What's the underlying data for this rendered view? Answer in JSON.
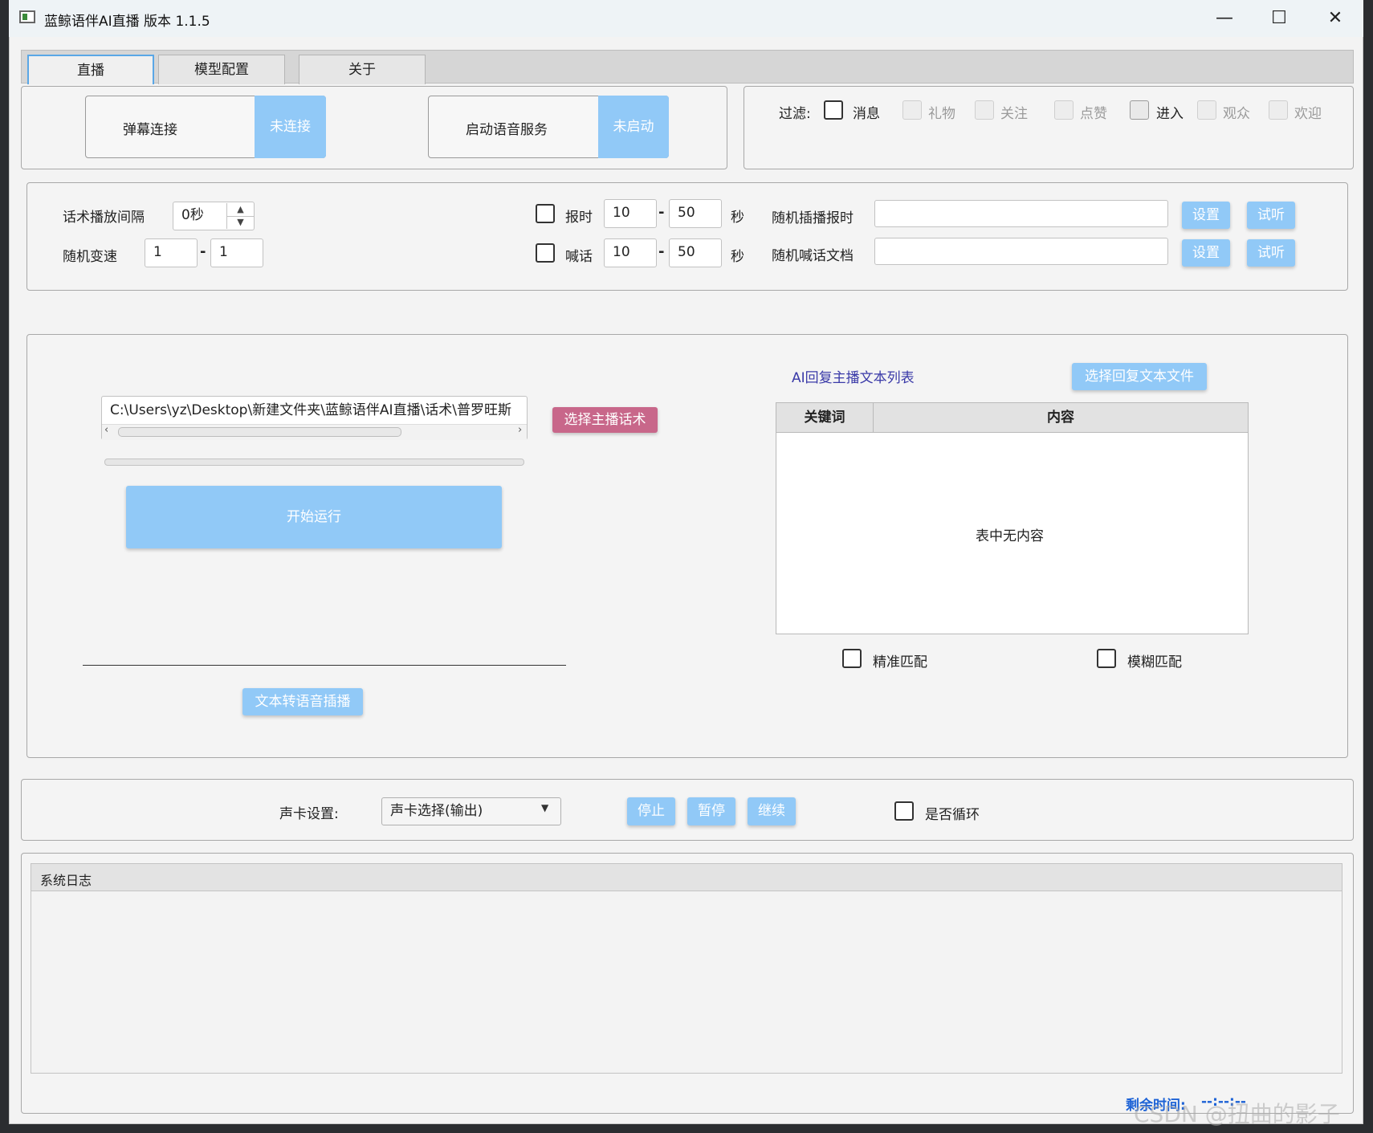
{
  "window": {
    "title": "蓝鲸语伴AI直播 版本 1.1.5",
    "minimize": "—",
    "maximize": "☐",
    "close": "✕"
  },
  "tabs": [
    "直播",
    "模型配置",
    "关于"
  ],
  "connection": {
    "danmu_label": "弹幕连接",
    "danmu_status": "未连接",
    "voice_label": "启动语音服务",
    "voice_status": "未启动"
  },
  "filter": {
    "label": "过滤:",
    "items": [
      {
        "label": "消息",
        "state": "enabled"
      },
      {
        "label": "礼物",
        "state": "disabled"
      },
      {
        "label": "关注",
        "state": "disabled"
      },
      {
        "label": "点赞",
        "state": "disabled"
      },
      {
        "label": "进入",
        "state": "enabled"
      },
      {
        "label": "观众",
        "state": "disabled"
      },
      {
        "label": "欢迎",
        "state": "disabled"
      }
    ]
  },
  "settings": {
    "interval_label": "话术播放间隔",
    "interval_value": "0秒",
    "speed_label": "随机变速",
    "speed_min": "1",
    "speed_max": "1",
    "time_label": "报时",
    "time_min": "10",
    "time_max": "50",
    "sec1": "秒",
    "shout_label": "喊话",
    "shout_min": "10",
    "shout_max": "50",
    "sec2": "秒",
    "random_time_label": "随机插播报时",
    "random_time_value": "",
    "random_shout_label": "随机喊话文档",
    "random_shout_value": "",
    "set_label": "设置",
    "listen_label": "试听"
  },
  "main": {
    "script_path": "C:\\Users\\yz\\Desktop\\新建文件夹\\蓝鲸语伴AI直播\\话术\\普罗旺斯",
    "select_script_btn": "选择主播话术",
    "start_btn": "开始运行",
    "tts_btn": "文本转语音插播",
    "progress": 0,
    "ai_list_title": "AI回复主播文本列表",
    "select_reply_btn": "选择回复文本文件",
    "table_headers": [
      "关键词",
      "内容"
    ],
    "table_empty": "表中无内容",
    "exact_match": "精准匹配",
    "fuzzy_match": "模糊匹配"
  },
  "sound": {
    "label": "声卡设置:",
    "select_value": "声卡选择(输出)",
    "stop": "停止",
    "pause": "暂停",
    "resume": "继续",
    "loop": "是否循环"
  },
  "log": {
    "title": "系统日志",
    "content": ""
  },
  "footer": {
    "remaining": "剩余时间:",
    "remaining_value": "--:--:--",
    "watermark": "CSDN @扭曲的影子"
  }
}
